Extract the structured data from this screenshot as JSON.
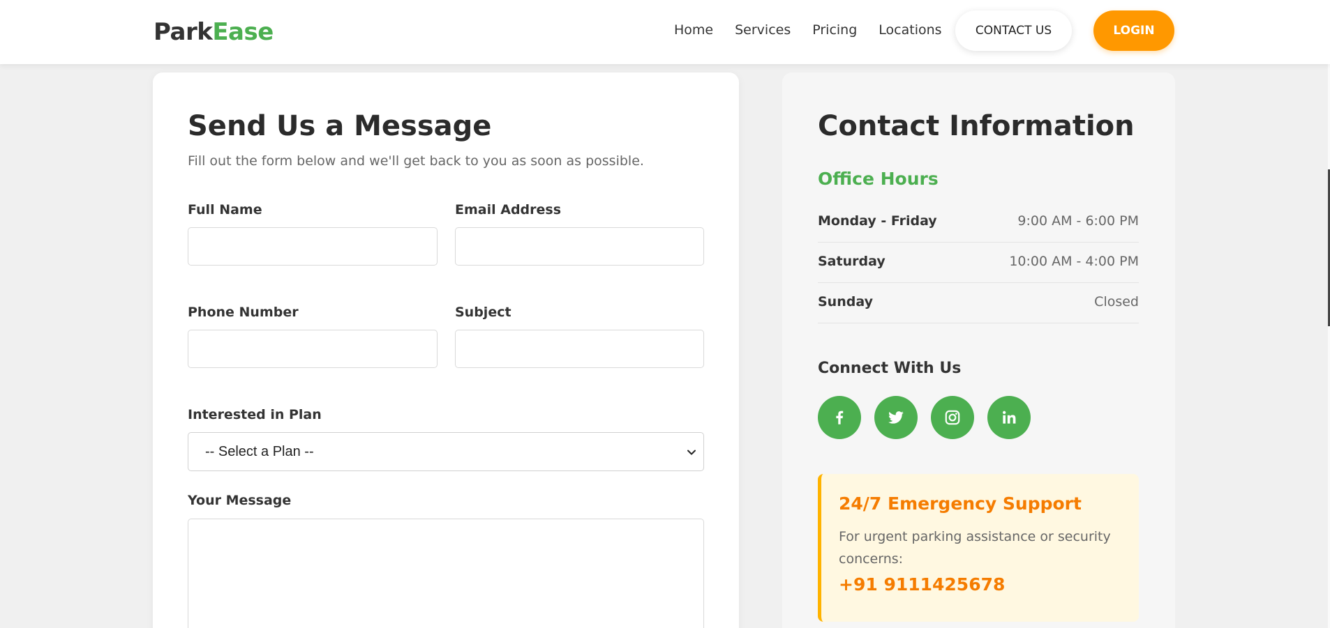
{
  "header": {
    "logo_part1": "Park",
    "logo_part2": "Ease",
    "nav": [
      "Home",
      "Services",
      "Pricing",
      "Locations"
    ],
    "contact_button": "CONTACT US",
    "login_button": "LOGIN"
  },
  "form": {
    "title": "Send Us a Message",
    "subtitle": "Fill out the form below and we'll get back to you as soon as possible.",
    "full_name_label": "Full Name",
    "full_name_value": "",
    "email_label": "Email Address",
    "email_value": "",
    "phone_label": "Phone Number",
    "phone_value": "",
    "subject_label": "Subject",
    "subject_value": "",
    "plan_label": "Interested in Plan",
    "plan_selected": "-- Select a Plan --",
    "message_label": "Your Message",
    "message_value": ""
  },
  "info": {
    "title": "Contact Information",
    "hours_title": "Office Hours",
    "hours": [
      {
        "day": "Monday - Friday",
        "time": "9:00 AM - 6:00 PM"
      },
      {
        "day": "Saturday",
        "time": "10:00 AM - 4:00 PM"
      },
      {
        "day": "Sunday",
        "time": "Closed"
      }
    ],
    "connect_title": "Connect With Us",
    "social": [
      "facebook-icon",
      "twitter-icon",
      "instagram-icon",
      "linkedin-icon"
    ],
    "emergency": {
      "title": "24/7 Emergency Support",
      "text": "For urgent parking assistance or security concerns:",
      "phone": "+91 9111425678"
    }
  },
  "colors": {
    "brand_green": "#4caf50",
    "login_orange": "#ff9800",
    "emergency_orange": "#f57c00",
    "emergency_bg": "#fff8e1"
  }
}
